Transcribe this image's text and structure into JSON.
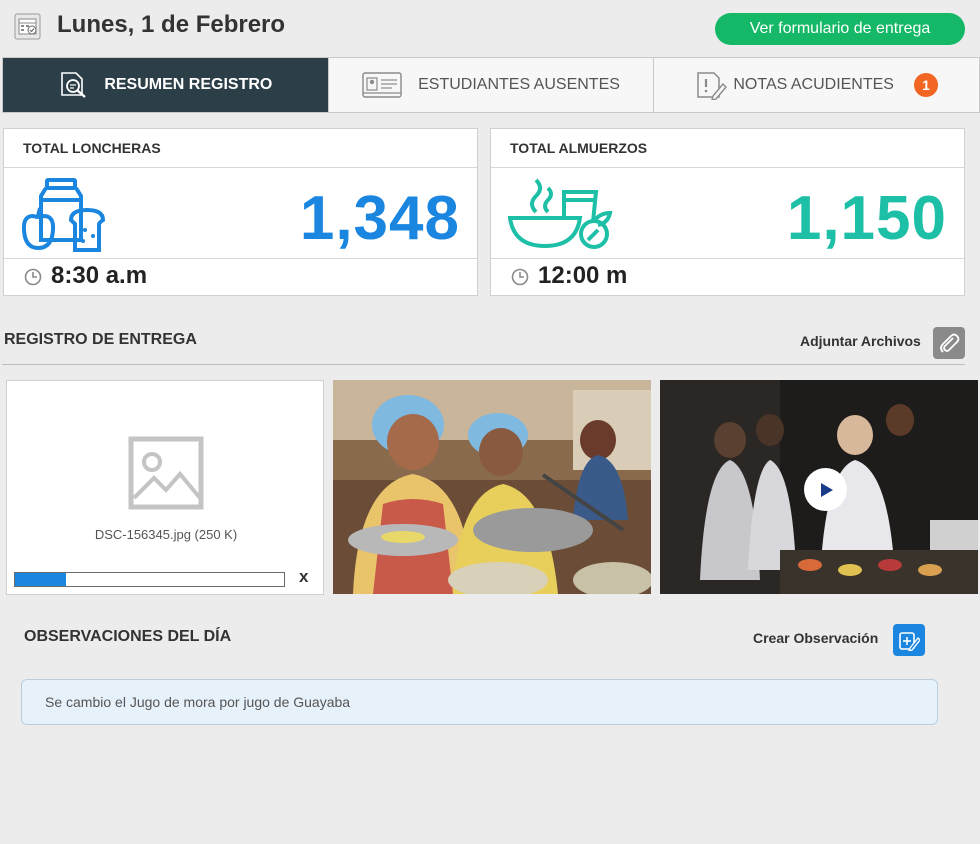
{
  "header": {
    "date": "Lunes, 1 de Febrero",
    "form_button": "Ver formulario de entrega"
  },
  "tabs": [
    {
      "label": "RESUMEN REGISTRO",
      "active": true,
      "icon": "search-document-icon"
    },
    {
      "label": "ESTUDIANTES AUSENTES",
      "active": false,
      "icon": "id-card-icon"
    },
    {
      "label": "NOTAS ACUDIENTES",
      "active": false,
      "icon": "note-alert-icon",
      "badge": "1"
    }
  ],
  "cards": [
    {
      "title": "TOTAL LONCHERAS",
      "value": "1,348",
      "time": "8:30 a.m",
      "color": "#1a86e0",
      "icon": "lunchbox-icon"
    },
    {
      "title": "TOTAL ALMUERZOS",
      "value": "1,150",
      "time": "12:00 m",
      "color": "#1dbfa7",
      "icon": "lunch-bowl-icon"
    }
  ],
  "delivery": {
    "title": "REGISTRO DE ENTREGA",
    "attach_label": "Adjuntar Archivos",
    "upload": {
      "filename": "DSC-156345.jpg (250 K)",
      "progress": 0.19,
      "remove": "x"
    }
  },
  "observations": {
    "title": "OBSERVACIONES DEL DÍA",
    "create_label": "Crear Observación",
    "items": [
      "Se cambio el Jugo de mora por jugo de Guayaba"
    ]
  },
  "colors": {
    "accent_green": "#14b866",
    "accent_blue": "#1a86e0",
    "teal": "#1dbfa7",
    "tab_dark": "#2c3e48",
    "badge": "#f26522"
  }
}
